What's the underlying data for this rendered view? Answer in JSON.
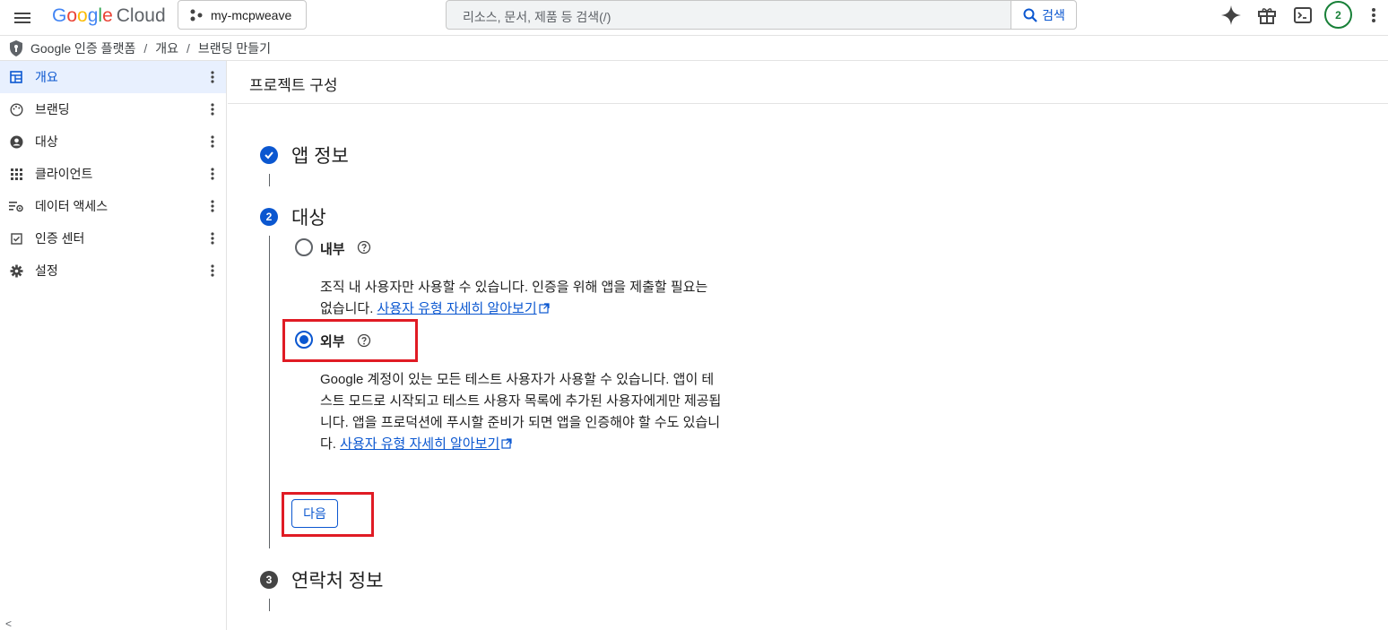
{
  "header": {
    "logo": {
      "google_letters": [
        "G",
        "o",
        "o",
        "g",
        "l",
        "e"
      ],
      "cloud": "Cloud"
    },
    "project": "my-mcpweave",
    "search_placeholder": "리소스, 문서, 제품 등 검색(/)",
    "search_button": "검색",
    "avatar_badge": "2"
  },
  "breadcrumb": {
    "items": [
      "Google 인증 플랫폼",
      "개요",
      "브랜딩 만들기"
    ],
    "separator": "/"
  },
  "sidebar": {
    "items": [
      {
        "label": "개요",
        "icon": "dashboard-icon",
        "active": true
      },
      {
        "label": "브랜딩",
        "icon": "palette-icon"
      },
      {
        "label": "대상",
        "icon": "account-circle-icon"
      },
      {
        "label": "클라이언트",
        "icon": "apps-grid-icon"
      },
      {
        "label": "데이터 액세스",
        "icon": "data-settings-icon"
      },
      {
        "label": "인증 센터",
        "icon": "verified-check-icon"
      },
      {
        "label": "설정",
        "icon": "gear-icon"
      }
    ],
    "footer": "<"
  },
  "main": {
    "page_title": "프로젝트 구성",
    "steps": [
      {
        "number": "",
        "title": "앱 정보",
        "status": "completed"
      },
      {
        "number": "2",
        "title": "대상",
        "status": "current"
      },
      {
        "number": "3",
        "title": "연락처 정보",
        "status": "pending"
      }
    ],
    "options": [
      {
        "label": "내부",
        "selected": false,
        "desc_text": "조직 내 사용자만 사용할 수 있습니다. 인증을 위해 앱을 제출할 필요는 없습니다.",
        "link": "사용자 유형 자세히 알아보기"
      },
      {
        "label": "외부",
        "selected": true,
        "desc_text": "Google 계정이 있는 모든 테스트 사용자가 사용할 수 있습니다. 앱이 테스트 모드로 시작되고 테스트 사용자 목록에 추가된 사용자에게만 제공됩니다. 앱을 프로덕션에 푸시할 준비가 되면 앱을 인증해야 할 수도 있습니다.",
        "link": "사용자 유형 자세히 알아보기"
      }
    ],
    "next_button": "다음"
  },
  "colors": {
    "accent": "#0b57d0",
    "highlight_box": "#e01b24",
    "active_nav_bg": "#e8f0fe"
  }
}
